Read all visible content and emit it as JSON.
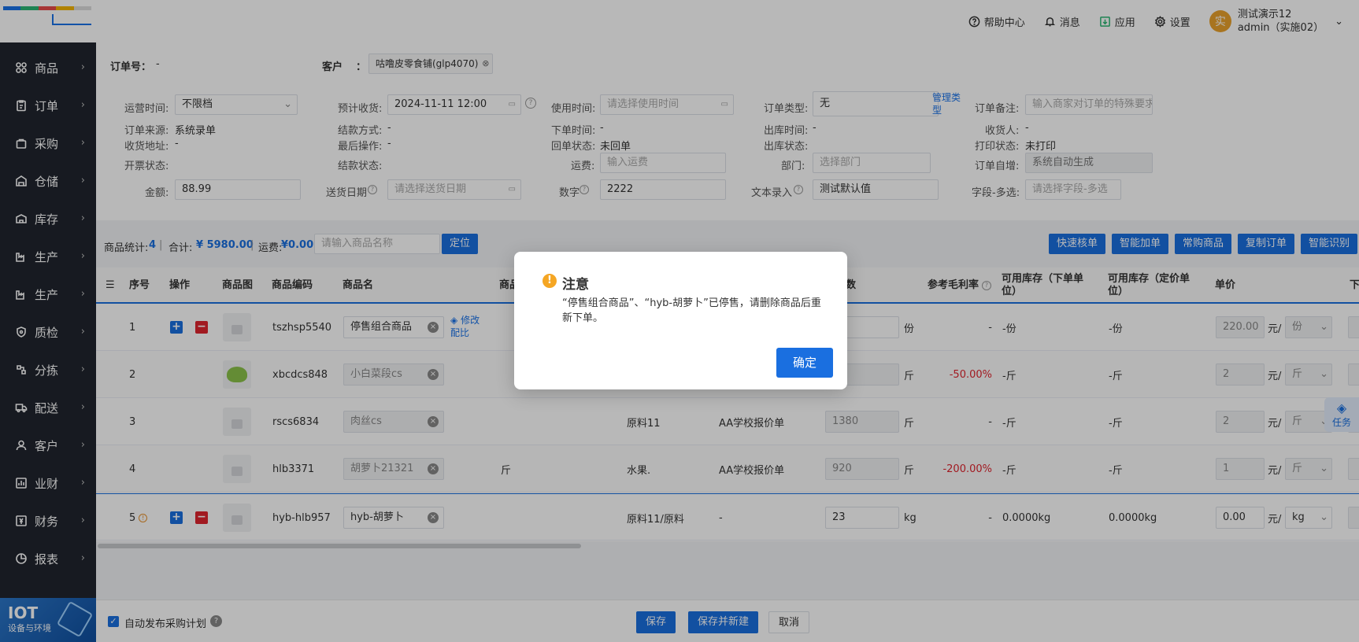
{
  "sidebar": {
    "items": [
      {
        "label": "商品",
        "icon": "grid-icon"
      },
      {
        "label": "订单",
        "icon": "clipboard-icon"
      },
      {
        "label": "采购",
        "icon": "bag-icon"
      },
      {
        "label": "仓储",
        "icon": "warehouse-icon"
      },
      {
        "label": "库存",
        "icon": "box-icon"
      },
      {
        "label": "生产",
        "icon": "factory-icon"
      },
      {
        "label": "生产",
        "icon": "factory-icon"
      },
      {
        "label": "质检",
        "icon": "shield-icon"
      },
      {
        "label": "分拣",
        "icon": "sort-icon"
      },
      {
        "label": "配送",
        "icon": "truck-icon"
      },
      {
        "label": "客户",
        "icon": "user-icon"
      },
      {
        "label": "业财",
        "icon": "chart-icon"
      },
      {
        "label": "财务",
        "icon": "money-icon"
      },
      {
        "label": "报表",
        "icon": "pie-icon"
      }
    ],
    "iot_title": "IOT",
    "iot_sub": "设备与环境"
  },
  "topbar": {
    "help": "帮助中心",
    "msg": "消息",
    "apps": "应用",
    "settings": "设置",
    "avatar_char": "实",
    "user_name": "测试演示12",
    "user_role": "admin（实施02）"
  },
  "form": {
    "order_no_label": "订单号：",
    "order_no": "-",
    "customer_label": "客户",
    "customer_colon": "：",
    "customer": "咕噜皮零食铺(glp4070)",
    "op_time_label": "运营时间:",
    "op_time": "不限档",
    "expected_label": "预计收货:",
    "expected": "2024-11-11 12:00",
    "use_time_label": "使用时间:",
    "use_time_ph": "请选择使用时间",
    "order_type_label": "订单类型:",
    "order_type": "无",
    "manage_type": "管理类型",
    "remark_label": "订单备注:",
    "remark_ph": "输入商家对订单的特殊要求",
    "source_label": "订单来源:",
    "source": "系统录单",
    "settle_label": "结款方式:",
    "settle": "-",
    "order_time_label": "下单时间:",
    "order_time": "-",
    "out_time_label": "出库时间:",
    "out_time": "-",
    "receiver_label": "收货人:",
    "receiver": "-",
    "address_label": "收货地址:",
    "address": "-",
    "last_op_label": "最后操作:",
    "last_op": "-",
    "return_label": "回单状态:",
    "return": "未回单",
    "out_status_label": "出库状态:",
    "print_label": "打印状态:",
    "print": "未打印",
    "invoice_label": "开票状态:",
    "settle_status_label": "结款状态:",
    "freight_label": "运费:",
    "freight_ph": "输入运费",
    "dept_label": "部门:",
    "dept_ph": "选择部门",
    "auto_label": "订单自增:",
    "auto": "系统自动生成",
    "amount_label": "金额:",
    "amount": "88.99",
    "delivery_label": "送货日期",
    "delivery_ph": "请选择送货日期",
    "number_label": "数字",
    "number": "2222",
    "text_label": "文本录入",
    "text": "测试默认值",
    "multi_label": "字段-多选:",
    "multi_ph": "请选择字段-多选"
  },
  "toolbar": {
    "stats_label": "商品统计:",
    "stats_count": "4",
    "total_label": "合计:",
    "total": "¥ 5980.00",
    "freight_label": "运费:",
    "freight": "¥0.00",
    "search_ph": "请输入商品名称",
    "locate": "定位",
    "btn1": "快速核单",
    "btn2": "智能加单",
    "btn3": "常购商品",
    "btn4": "复制订单",
    "btn5": "智能识别"
  },
  "table": {
    "headers": {
      "seq": "序号",
      "op": "操作",
      "img": "商品图",
      "code": "商品编码",
      "name": "商品名",
      "cat": "商品",
      "qty": "数",
      "margin": "参考毛利率",
      "stock1": "可用库存（下单单位）",
      "stock2": "可用库存（定价单位）",
      "price": "单价",
      "next": "下"
    },
    "rows": [
      {
        "seq": "1",
        "code": "tszhsp5540",
        "name": "停售组合商品",
        "edit": "修改配比",
        "qty": "",
        "qunit": "份",
        "margin": "-",
        "s1": "-份",
        "s2": "-份",
        "price": "220.00",
        "punit_pre": "元/",
        "punit": "份"
      },
      {
        "seq": "2",
        "code": "xbcdcs848",
        "name": "小白菜段cs",
        "qty": "0",
        "qunit": "斤",
        "margin": "-50.00%",
        "s1": "-斤",
        "s2": "-斤",
        "price": "2",
        "punit_pre": "元/",
        "punit": "斤"
      },
      {
        "seq": "3",
        "code": "rscs6834",
        "name": "肉丝cs",
        "cls": "原料11",
        "quote": "AA学校报价单",
        "qty": "1380",
        "qunit": "斤",
        "margin": "-",
        "s1": "-斤",
        "s2": "-斤",
        "price": "2",
        "punit_pre": "元/",
        "punit": "斤"
      },
      {
        "seq": "4",
        "code": "hlb3371",
        "name": "胡萝卜21321",
        "unit": "斤",
        "cls": "水果.",
        "quote": "AA学校报价单",
        "qty": "920",
        "qunit": "斤",
        "margin": "-200.00%",
        "s1": "-斤",
        "s2": "-斤",
        "price": "1",
        "punit_pre": "元/",
        "punit": "斤"
      },
      {
        "seq": "5",
        "code": "hyb-hlb957",
        "name": "hyb-胡萝卜",
        "cls": "原料11/原料",
        "quote": "-",
        "qty": "23",
        "qunit": "kg",
        "margin": "-",
        "s1": "0.0000kg",
        "s2": "0.0000kg",
        "price": "0.00",
        "punit_pre": "元/",
        "punit": "kg"
      }
    ]
  },
  "footer": {
    "auto_plan": "自动发布采购计划",
    "save": "保存",
    "save_new": "保存并新建",
    "cancel": "取消"
  },
  "task": "任务",
  "dialog": {
    "title": "注意",
    "message": "“停售组合商品”、“hyb-胡萝卜”已停售，请删除商品后重新下单。",
    "ok": "确定"
  },
  "colors": {
    "primary": "#1a6fe0",
    "warning": "#f5a623",
    "danger": "#e0242f",
    "sidebar": "#20252e"
  }
}
